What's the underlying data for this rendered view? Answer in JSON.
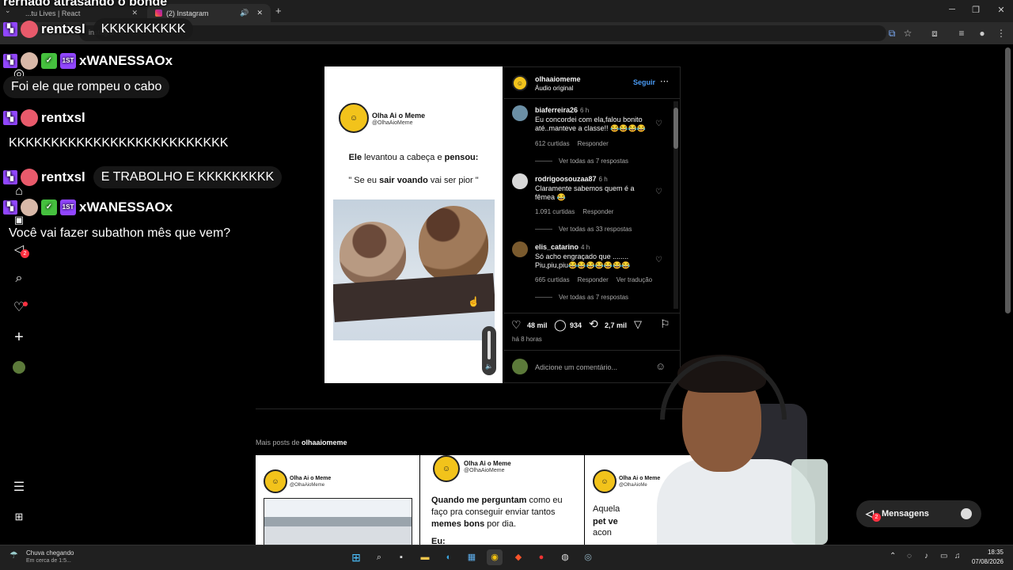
{
  "browser": {
    "tabs": [
      {
        "label": "...tu Lives | React"
      },
      {
        "label": "(2) Instagram"
      }
    ],
    "url_fragment": "instagra",
    "new_tab_symbol": "+"
  },
  "instagram": {
    "post": {
      "author": "olhaaiomeme",
      "audio": "Áudio original",
      "follow_label": "Seguir",
      "meme": {
        "brand_name": "Olha Ai o Meme",
        "brand_handle": "@OlhaAioMeme",
        "line1_a": "Ele",
        "line1_b": " levantou a cabeça e ",
        "line1_c": "pensou:",
        "line2_a": "\" Se eu ",
        "line2_b": "sair voando",
        "line2_c": " vai ser pior \""
      },
      "comments": [
        {
          "user": "biaferreira26",
          "time": "6 h",
          "text": "Eu concordei com ela,falou bonito até..manteve a classe!! 😂😂😂😂",
          "likes": "612 curtidas",
          "reply": "Responder",
          "translate": "",
          "more": "Ver todas as 7 respostas",
          "avatar_color": "#6b8fa5"
        },
        {
          "user": "rodrigoosouzaa87",
          "time": "6 h",
          "text": "Claramente sabemos quem é a fêmea 😂",
          "likes": "1.091 curtidas",
          "reply": "Responder",
          "translate": "",
          "more": "Ver todas as 33 respostas",
          "avatar_color": "#d9d9d9"
        },
        {
          "user": "elis_catarino",
          "time": "4 h",
          "text": "Só acho engraçado que ........ Piu,piu,piu😂😂😂😂😂😂😂",
          "likes": "665 curtidas",
          "reply": "Responder",
          "translate": "Ver tradução",
          "more": "Ver todas as 7 respostas",
          "avatar_color": "#7a5a2e"
        }
      ],
      "stats": {
        "likes": "48 mil",
        "comments": "934",
        "reposts": "2,7 mil"
      },
      "posted": "há 8 horas",
      "comment_placeholder": "Adicione um comentário..."
    },
    "more_posts": {
      "label": "Mais posts de",
      "user": "olhaaiomeme",
      "thumbs": [
        {
          "brand": "Olha Ai o Meme",
          "handle": "@OlhaAioMeme"
        },
        {
          "brand": "Olha Ai o Meme",
          "handle": "@OlhaAioMeme",
          "text_a": "Quando me perguntam",
          "text_b": " como eu faço pra conseguir enviar tantos ",
          "text_c": "memes bons",
          "text_d": " por dia.",
          "text_e": "Eu:"
        },
        {
          "brand": "Olha Ai o Meme",
          "handle": "@OlhaAioMe",
          "text_a": "Aquela",
          "text_b": "pet ve",
          "text_c": "acon"
        }
      ]
    },
    "messages_label": "Mensagens",
    "notif_count": "2",
    "messages_count": "2"
  },
  "chat": [
    {
      "user": "rentxsl",
      "msg": "KKKKKKKKKK"
    },
    {
      "user": "xWANESSAOx",
      "msg": "Foi ele que rompeu o cabo"
    },
    {
      "user": "rentxsl",
      "msg": "KKKKKKKKKKKKKKKKKKKKKKKKKK"
    },
    {
      "user": "rentxsl",
      "msg": "E TRABOLHO E KKKKKKKKK"
    },
    {
      "user": "xWANESSAOx",
      "msg": "Você vai fazer subathon mês que vem?"
    },
    {
      "top_clipped": "rernado atrasando o bonde"
    }
  ],
  "badges": {
    "first": "1ST"
  },
  "taskbar": {
    "weather_title": "Chuva chegando",
    "weather_sub": "Em cerca de 1:5...",
    "time": "18:35",
    "date": "07/08/2026"
  }
}
